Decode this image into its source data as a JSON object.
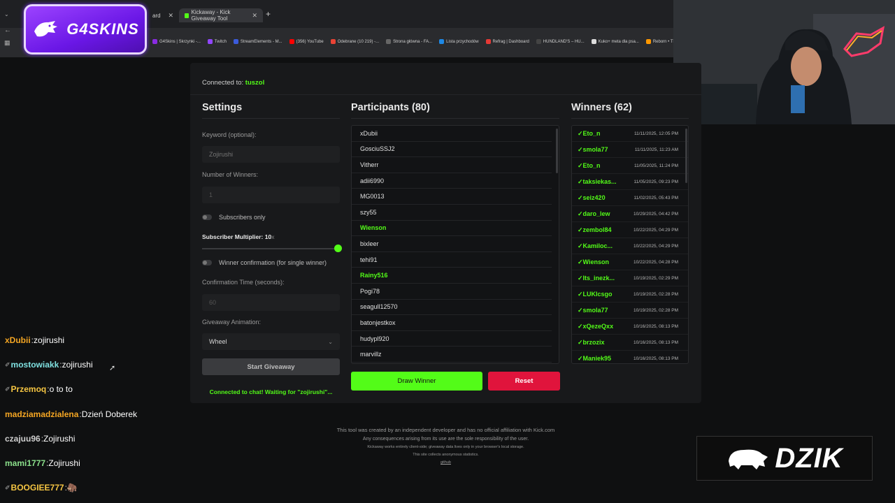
{
  "browser": {
    "prev_tab_label": "ard",
    "active_tab_label": "Kickaway - Kick Giveaway Tool",
    "bookmarks": [
      {
        "label": "G4Skins | Skrzynki -...",
        "color": "#8a2be2"
      },
      {
        "label": "Twitch",
        "color": "#9146ff"
      },
      {
        "label": "StreamElements - M...",
        "color": "#3b5bdb"
      },
      {
        "label": "(356) YouTube",
        "color": "#ff0000"
      },
      {
        "label": "Odebrane (10 219) -...",
        "color": "#ea4335"
      },
      {
        "label": "Strona główna - FA...",
        "color": "#666666"
      },
      {
        "label": "Lista przychodów",
        "color": "#1e88e5"
      },
      {
        "label": "Refrag | Dashboard",
        "color": "#e53935"
      },
      {
        "label": "HUNDLAND'S – HU...",
        "color": "#444444"
      },
      {
        "label": "Kuko+ meta dla psa...",
        "color": "#dddddd"
      },
      {
        "label": "Reborn • The Ho",
        "color": "#ff9800"
      }
    ]
  },
  "overlay": {
    "g4skins_logo": "G4SKINS",
    "dzik_logo": "DZIK"
  },
  "app": {
    "connected_label": "Connected to:",
    "connected_channel": "tuszol",
    "settings": {
      "title": "Settings",
      "keyword_label": "Keyword (optional):",
      "keyword_placeholder": "Zojirushi",
      "winners_label": "Number of Winners:",
      "winners_value": "1",
      "subscribers_only_label": "Subscribers only",
      "multiplier_label": "Subscriber Multiplier: 10",
      "multiplier_suffix": "x",
      "multiplier_level": 1.0,
      "winner_confirmation_label": "Winner confirmation (for single winner)",
      "confirmation_time_label": "Confirmation Time (seconds):",
      "confirmation_time_value": "60",
      "animation_label": "Giveaway Animation:",
      "animation_value": "Wheel",
      "start_button": "Start Giveaway",
      "status_text": "Connected to chat! Waiting for \"zojirushi\"..."
    },
    "participants": {
      "title": "Participants (80)",
      "items": [
        {
          "name": "xDubii",
          "winner": false
        },
        {
          "name": "GosciuSSJ2",
          "winner": false
        },
        {
          "name": "Vitherr",
          "winner": false
        },
        {
          "name": "adii6990",
          "winner": false
        },
        {
          "name": "MG0013",
          "winner": false
        },
        {
          "name": "szy55",
          "winner": false
        },
        {
          "name": "Wienson",
          "winner": true
        },
        {
          "name": "bixleer",
          "winner": false
        },
        {
          "name": "tehi91",
          "winner": false
        },
        {
          "name": "Rainy516",
          "winner": true
        },
        {
          "name": "Pogi78",
          "winner": false
        },
        {
          "name": "seagull12570",
          "winner": false
        },
        {
          "name": "batonjestkox",
          "winner": false
        },
        {
          "name": "hudypl920",
          "winner": false
        },
        {
          "name": "marvillz",
          "winner": false
        }
      ],
      "draw_button": "Draw Winner",
      "reset_button": "Reset"
    },
    "winners": {
      "title": "Winners (62)",
      "items": [
        {
          "name": "✓Eto_n",
          "date": "11/11/2025, 12:05 PM"
        },
        {
          "name": "✓smola77",
          "date": "11/11/2025, 11:23 AM"
        },
        {
          "name": "✓Eto_n",
          "date": "11/05/2025, 11:24 PM"
        },
        {
          "name": "✓taksiekas...",
          "date": "11/05/2025, 09:23 PM"
        },
        {
          "name": "✓seiz420",
          "date": "11/02/2025, 05:43 PM"
        },
        {
          "name": "✓daro_lew",
          "date": "10/29/2025, 04:42 PM"
        },
        {
          "name": "✓zembol84",
          "date": "10/22/2025, 04:29 PM"
        },
        {
          "name": "✓Kamiloc...",
          "date": "10/22/2025, 04:29 PM"
        },
        {
          "name": "✓Wienson",
          "date": "10/22/2025, 04:28 PM"
        },
        {
          "name": "✓Its_inezk...",
          "date": "10/19/2025, 02:29 PM"
        },
        {
          "name": "✓LUKIcsgo",
          "date": "10/19/2025, 02:28 PM"
        },
        {
          "name": "✓smola77",
          "date": "10/19/2025, 02:28 PM"
        },
        {
          "name": "✓xQezeQxx",
          "date": "10/16/2025, 08:13 PM"
        },
        {
          "name": "✓brzozix",
          "date": "10/16/2025, 08:13 PM"
        },
        {
          "name": "✓Maniek95",
          "date": "10/16/2025, 08:13 PM"
        }
      ]
    },
    "footer": {
      "line1": "This tool was created by an independent developer and has no official affiliation with Kick.com",
      "line2": "Any consequences arising from its use are the sole responsibility of the user.",
      "line3": "Kickaway works entirely client-side; giveaway data lives only in your browser's local storage.",
      "line4": "This site collects anonymous statistics.",
      "link": "github"
    }
  },
  "chat": [
    {
      "user": "xDubii",
      "message": "zojirushi",
      "color": "#f5a623",
      "badge": false
    },
    {
      "user": "mostowiakk",
      "message": "zojirushi",
      "color": "#7fe0e0",
      "badge": true
    },
    {
      "user": "Przemoq",
      "message": "o to to",
      "color": "#f5c542",
      "badge": true
    },
    {
      "user": "madziamadzialena",
      "message": "Dzień Doberek",
      "color": "#f5a623",
      "badge": false
    },
    {
      "user": "czajuu96",
      "message": "Zojirushi",
      "color": "#cfcfcf",
      "badge": false
    },
    {
      "user": "mami1777",
      "message": "Zojirushi",
      "color": "#8be08b",
      "badge": false
    },
    {
      "user": "BOOGIEE777",
      "message": "🦣",
      "color": "#f5c542",
      "badge": true
    }
  ]
}
